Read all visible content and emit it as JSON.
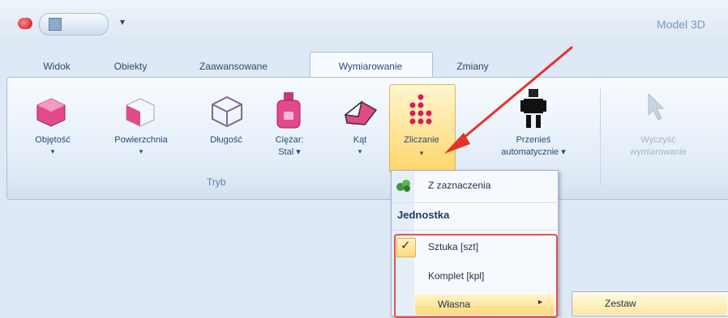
{
  "window": {
    "title": "Model 3D"
  },
  "quick_access": {
    "arrow": "▾"
  },
  "tabs": [
    "Widok",
    "Obiekty",
    "Zaawansowane",
    "Wymiarowanie",
    "Zmiany"
  ],
  "active_tab": "Wymiarowanie",
  "ribbon": {
    "buttons": [
      {
        "label": "Objętość",
        "dropdown": "▾"
      },
      {
        "label": "Powierzchnia",
        "dropdown": "▾"
      },
      {
        "label": "Długość"
      },
      {
        "label": "Ciężar:",
        "label2": "Stal ▾"
      },
      {
        "label": "Kąt",
        "dropdown": "▾"
      },
      {
        "label": "Zliczanie",
        "dropdown": "▾"
      },
      {
        "label": "Przenieś",
        "label2": "automatycznie ▾"
      },
      {
        "label": "Wyczyść",
        "label2": "wymiarowanie"
      }
    ],
    "group_label": "Tryb"
  },
  "menu": {
    "item1": "Z zaznaczenia",
    "heading": "Jednostka",
    "item2": "Sztuka [szt]",
    "item3": "Komplet [kpl]",
    "item4": "Własna",
    "submenu_item": "Zestaw"
  },
  "colors": {
    "accent_highlight": "#e8524a",
    "hover": "#ffd87a"
  }
}
